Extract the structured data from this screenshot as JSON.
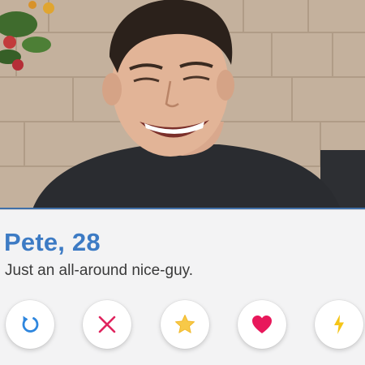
{
  "profile": {
    "name_age": "Pete, 28",
    "bio": "Just an all-around nice-guy."
  },
  "actions": [
    {
      "name": "rewind-button",
      "icon": "rewind-icon",
      "color": "#2e86de"
    },
    {
      "name": "nope-button",
      "icon": "close-icon",
      "color": "#e0245e"
    },
    {
      "name": "super-like-button",
      "icon": "star-icon",
      "color": "#f7c948"
    },
    {
      "name": "like-button",
      "icon": "heart-icon",
      "color": "#e8185b"
    },
    {
      "name": "boost-button",
      "icon": "lightning-icon",
      "color": "#f5c518"
    }
  ],
  "colors": {
    "name_text": "#3d7bc4",
    "bio_text": "#3a3a3a",
    "panel_bg": "#f3f3f4"
  }
}
